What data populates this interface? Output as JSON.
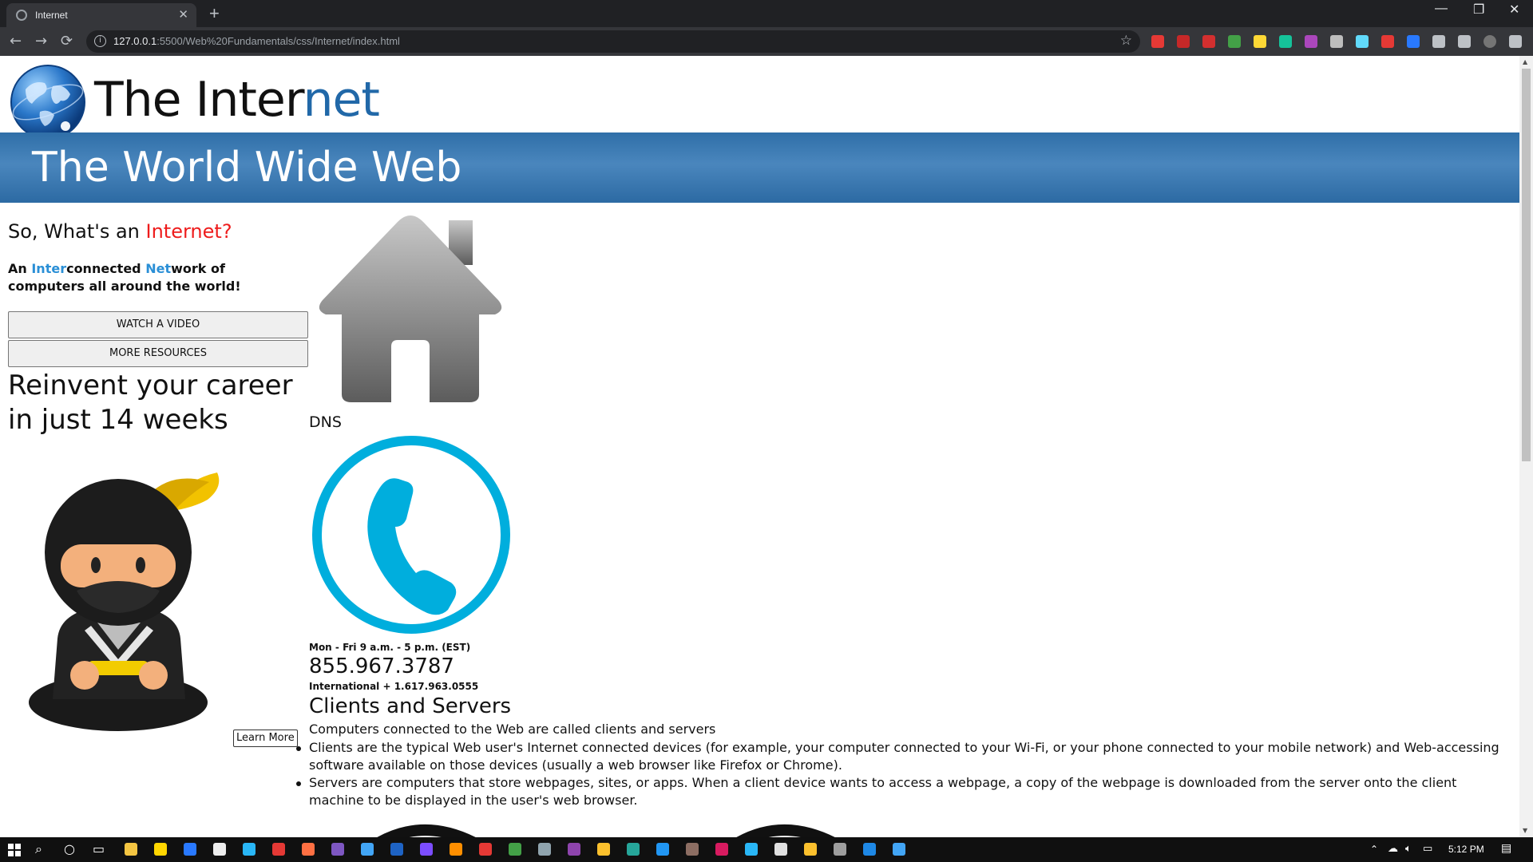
{
  "browser": {
    "tab_title": "Internet",
    "tab_close": "✕",
    "new_tab": "+",
    "url_host": "127.0.0.1",
    "url_path": ":5500/Web%20Fundamentals/css/Internet/index.html",
    "back": "←",
    "forward": "→",
    "reload": "⟳",
    "info": "i",
    "bookmark": "☆",
    "minimize": "—",
    "restore": "❐",
    "close": "✕",
    "extensions": [
      {
        "name": "ext-red-icon",
        "color": "#e53935"
      },
      {
        "name": "ext-block-icon",
        "color": "#c62828"
      },
      {
        "name": "ext-stop-icon",
        "color": "#d32f2f"
      },
      {
        "name": "ext-green-icon",
        "color": "#43a047"
      },
      {
        "name": "ext-yellow-icon",
        "color": "#fdd835"
      },
      {
        "name": "ext-grammarly-icon",
        "color": "#15c39a"
      },
      {
        "name": "ext-colorpick-icon",
        "color": "#ab47bc"
      },
      {
        "name": "ext-camera-icon",
        "color": "#bdbdbd"
      },
      {
        "name": "ext-react-icon",
        "color": "#61dafb"
      },
      {
        "name": "ext-book-icon",
        "color": "#e53935"
      },
      {
        "name": "ext-li-icon",
        "color": "#2979ff"
      },
      {
        "name": "puzzle-icon",
        "color": "#bdc1c6"
      },
      {
        "name": "reading-list-icon",
        "color": "#bdc1c6"
      },
      {
        "name": "profile-avatar-icon",
        "color": "#757575"
      },
      {
        "name": "menu-icon",
        "color": "#bdc1c6"
      }
    ]
  },
  "page": {
    "title_start": "The Inter",
    "title_accent": "net",
    "banner": "The World Wide Web",
    "question_start": "So, What's an ",
    "question_accent": "Internet?",
    "desc_1": "An ",
    "desc_inter": "Inter",
    "desc_2": "connected ",
    "desc_net": "Net",
    "desc_3": "work of computers all around the world!",
    "watch_video": "WATCH A VIDEO",
    "more_resources": "MORE RESOURCES",
    "career": "Reinvent your career in just 14 weeks",
    "learn_more": "Learn More",
    "dns": "DNS",
    "hours": "Mon - Fri 9 a.m. - 5 p.m. (EST)",
    "phone": "855.967.3787",
    "international": "International + 1.617.963.0555",
    "clients_heading": "Clients and Servers",
    "clients_intro": "Computers connected to the Web are called clients and servers",
    "clients_items": [
      "Clients are the typical Web user's Internet connected devices (for example, your computer connected to your Wi-Fi, or your phone connected to your mobile network) and Web-accessing software available on those devices (usually a web browser like Firefox or Chrome).",
      "Servers are computers that store webpages, sites, or apps. When a client device wants to access a webpage, a copy of the webpage is downloaded from the server onto the client machine to be displayed in the user's web browser."
    ],
    "colors": {
      "accent_blue": "#2168a8",
      "red": "#ee1c1c",
      "link_blue": "#2a8fd6",
      "phone_cyan": "#00aedd"
    }
  },
  "taskbar": {
    "clock": "5:12 PM",
    "apps": [
      {
        "name": "file-explorer-icon",
        "color": "#f4c542"
      },
      {
        "name": "sticky-notes-icon",
        "color": "#ffd600"
      },
      {
        "name": "todo-icon",
        "color": "#2979ff"
      },
      {
        "name": "store-icon",
        "color": "#eeeeee"
      },
      {
        "name": "app-square-icon",
        "color": "#29b6f6"
      },
      {
        "name": "app-target-icon",
        "color": "#e53935"
      },
      {
        "name": "firefox-icon",
        "color": "#ff7043"
      },
      {
        "name": "app-feather-icon",
        "color": "#7e57c2"
      },
      {
        "name": "app-gear-icon",
        "color": "#42a5f5"
      },
      {
        "name": "word-icon",
        "color": "#1e63c4"
      },
      {
        "name": "messenger-icon",
        "color": "#7c4dff"
      },
      {
        "name": "vlc-icon",
        "color": "#ff8f00"
      },
      {
        "name": "acrobat-icon",
        "color": "#e53935"
      },
      {
        "name": "app-green-icon",
        "color": "#43a047"
      },
      {
        "name": "steam-icon",
        "color": "#90a4ae"
      },
      {
        "name": "visual-studio-icon",
        "color": "#8e44ad"
      },
      {
        "name": "chrome-icon",
        "color": "#fbc02d"
      },
      {
        "name": "edge-icon",
        "color": "#26a69a"
      },
      {
        "name": "vscode-icon",
        "color": "#2196f3"
      },
      {
        "name": "app-fox-icon",
        "color": "#8d6e63"
      },
      {
        "name": "xd-icon",
        "color": "#d81b60"
      },
      {
        "name": "telegram-icon",
        "color": "#29b6f6"
      },
      {
        "name": "app-cloud-icon",
        "color": "#e0e0e0"
      },
      {
        "name": "chrome-2-icon",
        "color": "#fbc02d"
      },
      {
        "name": "calculator-icon",
        "color": "#9e9e9e"
      },
      {
        "name": "photos-icon",
        "color": "#1e88e5"
      },
      {
        "name": "app-python-icon",
        "color": "#42a5f5"
      }
    ]
  }
}
